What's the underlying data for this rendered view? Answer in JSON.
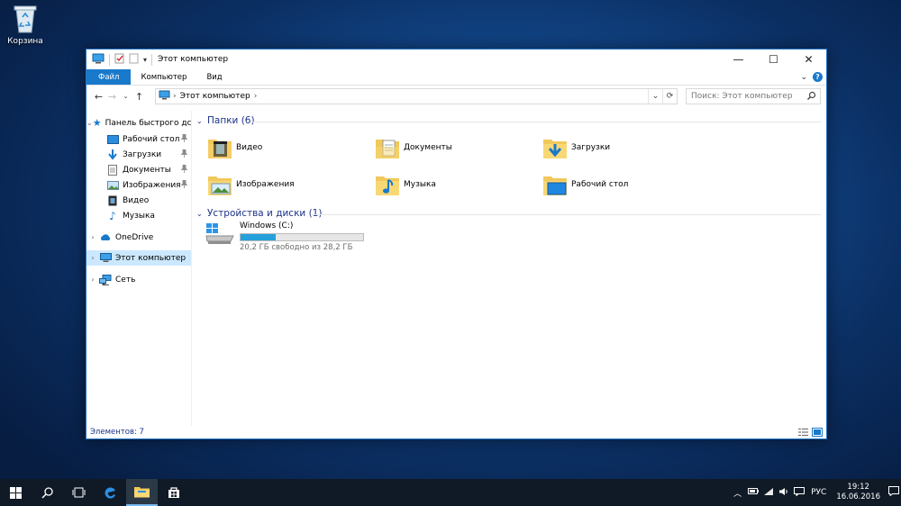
{
  "desktop": {
    "recycle_bin_label": "Корзина"
  },
  "window": {
    "title": "Этот компьютер",
    "controls": {
      "minimize": "—",
      "maximize": "☐",
      "close": "✕"
    }
  },
  "ribbon": {
    "tabs": [
      {
        "label": "Файл",
        "active": true
      },
      {
        "label": "Компьютер",
        "active": false
      },
      {
        "label": "Вид",
        "active": false
      }
    ],
    "help": "?"
  },
  "address_bar": {
    "location": "Этот компьютер",
    "search_placeholder": "Поиск: Этот компьютер"
  },
  "sidebar": {
    "quick_access": "Панель быстрого дс",
    "pinned": [
      {
        "label": "Рабочий стол",
        "icon": "desktop-icon"
      },
      {
        "label": "Загрузки",
        "icon": "downloads-icon"
      },
      {
        "label": "Документы",
        "icon": "documents-icon"
      },
      {
        "label": "Изображения",
        "icon": "pictures-icon"
      },
      {
        "label": "Видео",
        "icon": "video-icon"
      },
      {
        "label": "Музыка",
        "icon": "music-icon"
      }
    ],
    "onedrive": "OneDrive",
    "this_pc": "Этот компьютер",
    "network": "Сеть"
  },
  "content": {
    "folders_header": "Папки (6)",
    "folders": [
      {
        "label": "Видео",
        "icon": "video-folder-icon"
      },
      {
        "label": "Документы",
        "icon": "documents-folder-icon"
      },
      {
        "label": "Загрузки",
        "icon": "downloads-folder-icon"
      },
      {
        "label": "Изображения",
        "icon": "pictures-folder-icon"
      },
      {
        "label": "Музыка",
        "icon": "music-folder-icon"
      },
      {
        "label": "Рабочий стол",
        "icon": "desktop-folder-icon"
      }
    ],
    "devices_header": "Устройства и диски (1)",
    "drive": {
      "name": "Windows (C:)",
      "free_text": "20,2 ГБ свободно из 28,2 ГБ",
      "used_fraction": 0.284
    }
  },
  "status": {
    "items_count": "Элементов: 7"
  },
  "taskbar": {
    "language": "РУС",
    "time": "19:12",
    "date": "16.06.2016"
  },
  "colors": {
    "accent": "#1979ca",
    "group_header": "#1e3287",
    "selection": "#cce8ff",
    "drive_fill": "#26a0da"
  }
}
